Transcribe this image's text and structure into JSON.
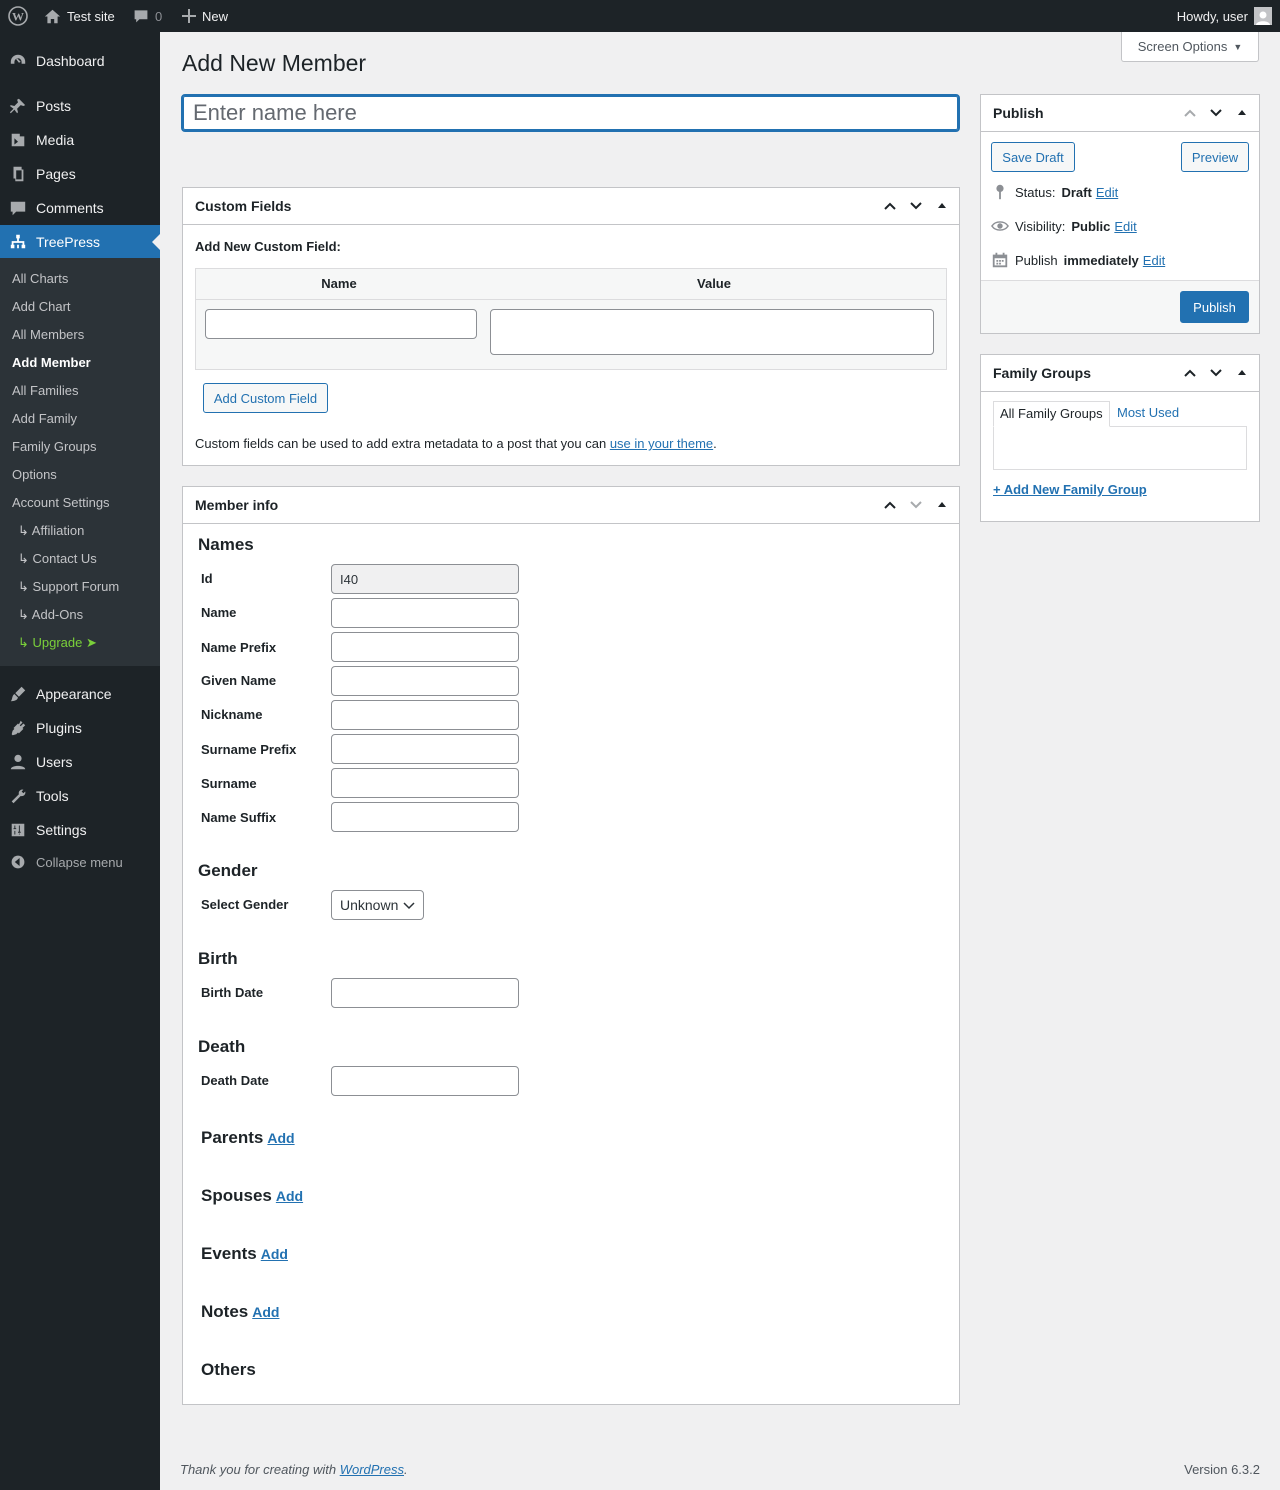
{
  "adminbar": {
    "site": "Test site",
    "comments": "0",
    "new": "New",
    "howdy": "Howdy, user"
  },
  "menu": {
    "items": [
      "Dashboard",
      "Posts",
      "Media",
      "Pages",
      "Comments",
      "TreePress",
      "Appearance",
      "Plugins",
      "Users",
      "Tools",
      "Settings"
    ],
    "submenu": [
      "All Charts",
      "Add Chart",
      "All Members",
      "Add Member",
      "All Families",
      "Add Family",
      "Family Groups",
      "Options",
      "Account Settings",
      "↳ Affiliation",
      "↳ Contact Us",
      "↳ Support Forum",
      "↳ Add-Ons",
      "↳ Upgrade ➤"
    ],
    "collapse": "Collapse menu"
  },
  "page": {
    "title": "Add New Member",
    "screen_options": "Screen Options",
    "name_placeholder": "Enter name here"
  },
  "custom_fields": {
    "title": "Custom Fields",
    "add_label": "Add New Custom Field:",
    "col_name": "Name",
    "col_value": "Value",
    "add_button": "Add Custom Field",
    "help_prefix": "Custom fields can be used to add extra metadata to a post that you can ",
    "help_link": "use in your theme",
    "help_suffix": "."
  },
  "member_info": {
    "title": "Member info",
    "names_heading": "Names",
    "fields": [
      {
        "label": "Id",
        "value": "I40"
      },
      {
        "label": "Name",
        "value": ""
      },
      {
        "label": "Name Prefix",
        "value": ""
      },
      {
        "label": "Given Name",
        "value": ""
      },
      {
        "label": "Nickname",
        "value": ""
      },
      {
        "label": "Surname Prefix",
        "value": ""
      },
      {
        "label": "Surname",
        "value": ""
      },
      {
        "label": "Name Suffix",
        "value": ""
      }
    ],
    "gender_heading": "Gender",
    "gender_label": "Select Gender",
    "gender_value": "Unknown",
    "birth_heading": "Birth",
    "birth_label": "Birth Date",
    "death_heading": "Death",
    "death_label": "Death Date",
    "parents": "Parents",
    "spouses": "Spouses",
    "events": "Events",
    "notes": "Notes",
    "others": "Others",
    "add": "Add"
  },
  "publish": {
    "title": "Publish",
    "save_draft": "Save Draft",
    "preview": "Preview",
    "status_label": "Status:",
    "status_value": "Draft",
    "visibility_label": "Visibility:",
    "visibility_value": "Public",
    "publish_label": "Publish",
    "publish_value": "immediately",
    "edit": "Edit",
    "publish_button": "Publish"
  },
  "family_groups": {
    "title": "Family Groups",
    "tab_all": "All Family Groups",
    "tab_most": "Most Used",
    "add_new": "+ Add New Family Group"
  },
  "footer": {
    "thanks_prefix": "Thank you for creating with ",
    "thanks_link": "WordPress",
    "thanks_suffix": ".",
    "version": "Version 6.3.2"
  }
}
